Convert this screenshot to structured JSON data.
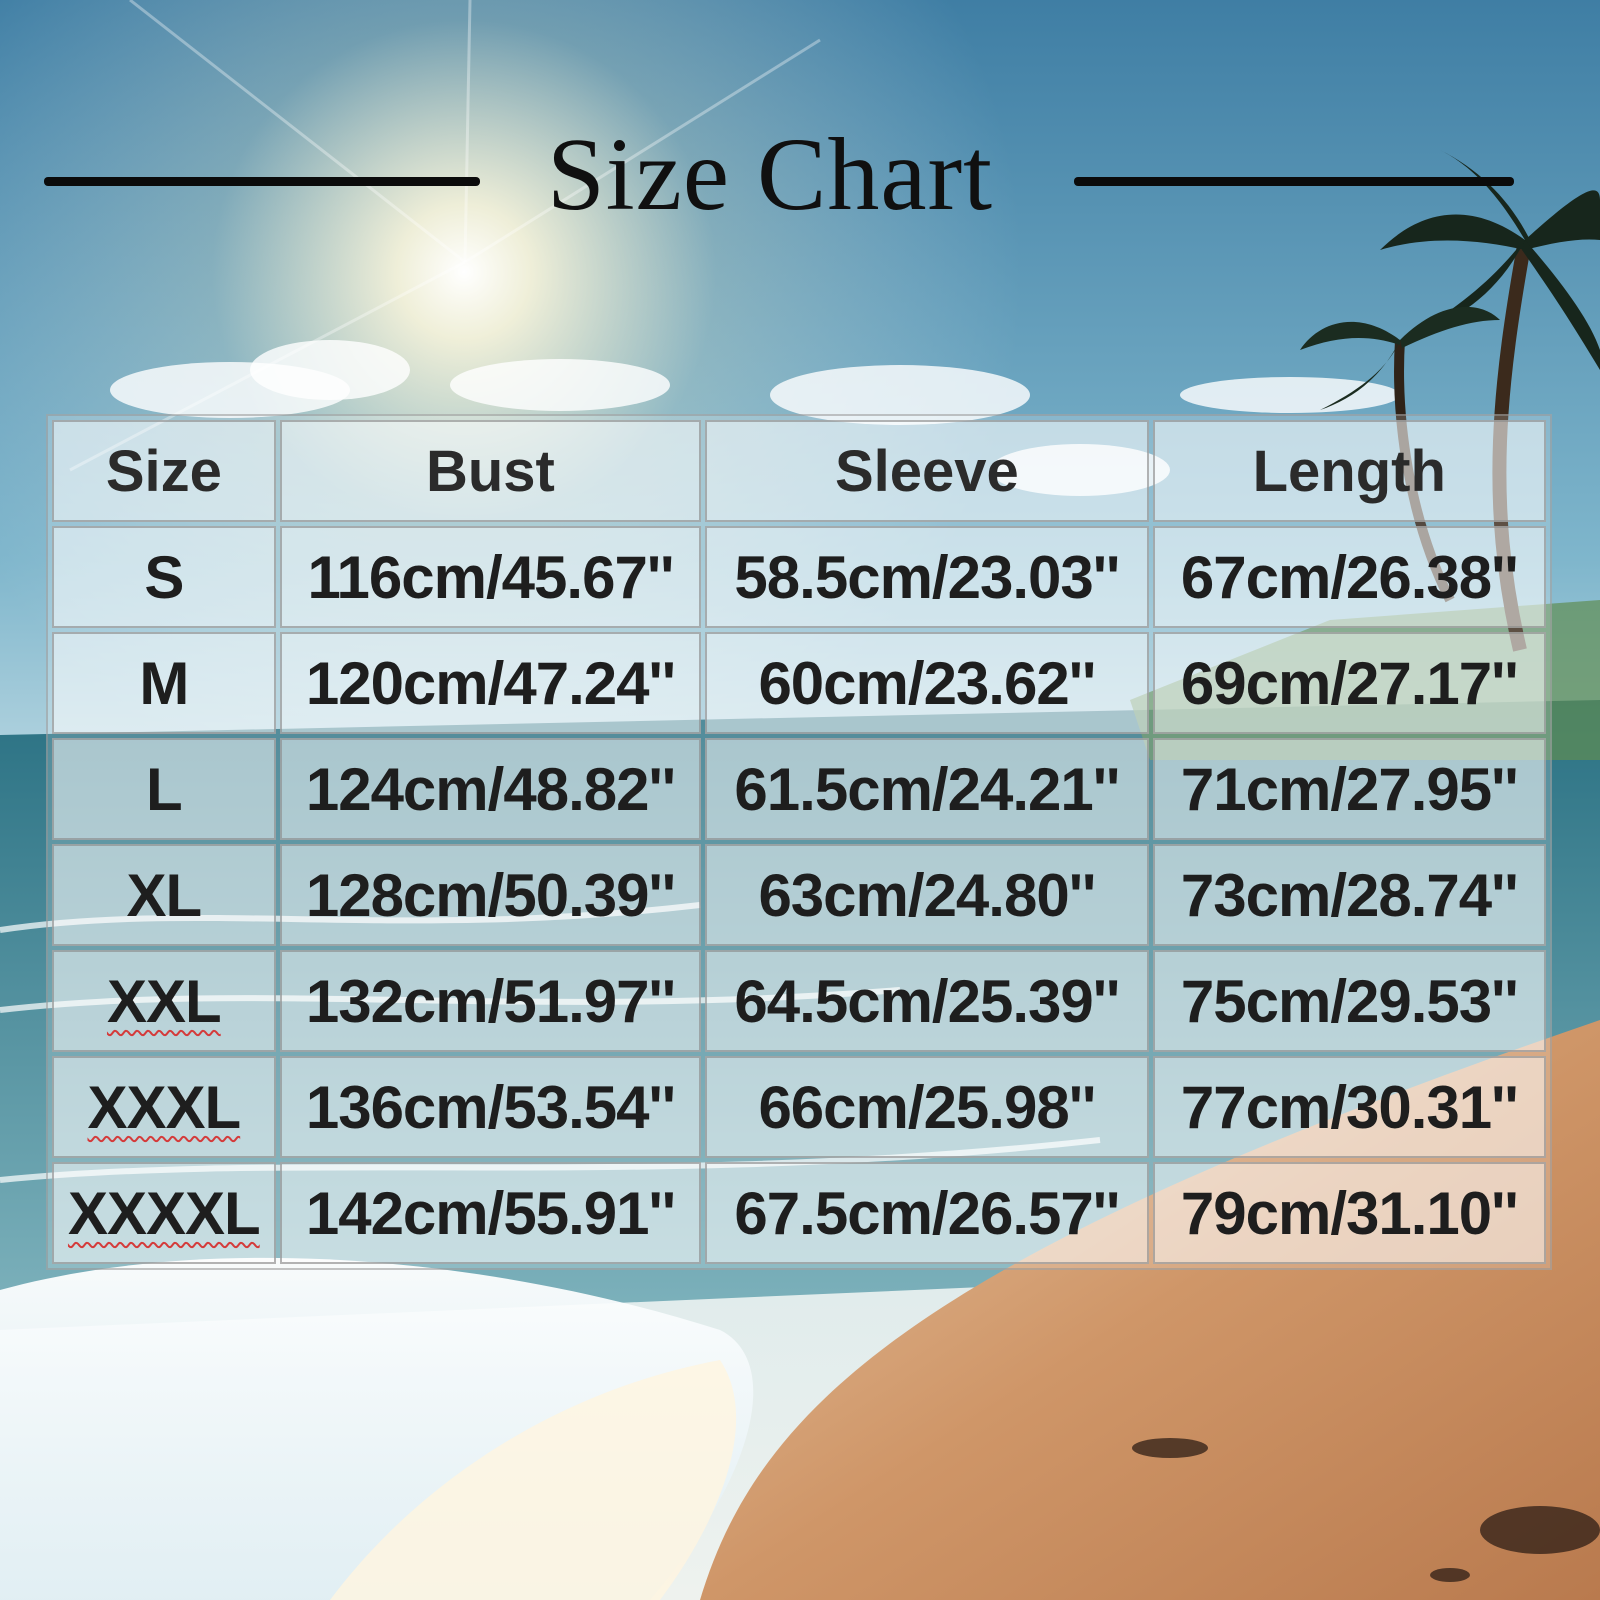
{
  "title": "Size Chart",
  "table": {
    "headers": [
      "Size",
      "Bust",
      "Sleeve",
      "Length"
    ],
    "rows": [
      {
        "size": "S",
        "bust": "116cm/45.67''",
        "sleeve": "58.5cm/23.03''",
        "length": "67cm/26.38''"
      },
      {
        "size": "M",
        "bust": "120cm/47.24''",
        "sleeve": "60cm/23.62''",
        "length": "69cm/27.17''"
      },
      {
        "size": "L",
        "bust": "124cm/48.82''",
        "sleeve": "61.5cm/24.21''",
        "length": "71cm/27.95''"
      },
      {
        "size": "XL",
        "bust": "128cm/50.39''",
        "sleeve": "63cm/24.80''",
        "length": "73cm/28.74''"
      },
      {
        "size": "XXL",
        "bust": "132cm/51.97''",
        "sleeve": "64.5cm/25.39''",
        "length": "75cm/29.53''"
      },
      {
        "size": "XXXL",
        "bust": "136cm/53.54''",
        "sleeve": "66cm/25.98''",
        "length": "77cm/30.31''"
      },
      {
        "size": "XXXXL",
        "bust": "142cm/55.91''",
        "sleeve": "67.5cm/26.57''",
        "length": "79cm/31.10''"
      }
    ]
  },
  "colors": {
    "sky_top": "#4f8fb2",
    "sky_horizon": "#d8e9ee",
    "sea": "#2f8190",
    "sand": "#c98d62",
    "title_text": "#101010",
    "cell_text": "#1e1e1e"
  }
}
